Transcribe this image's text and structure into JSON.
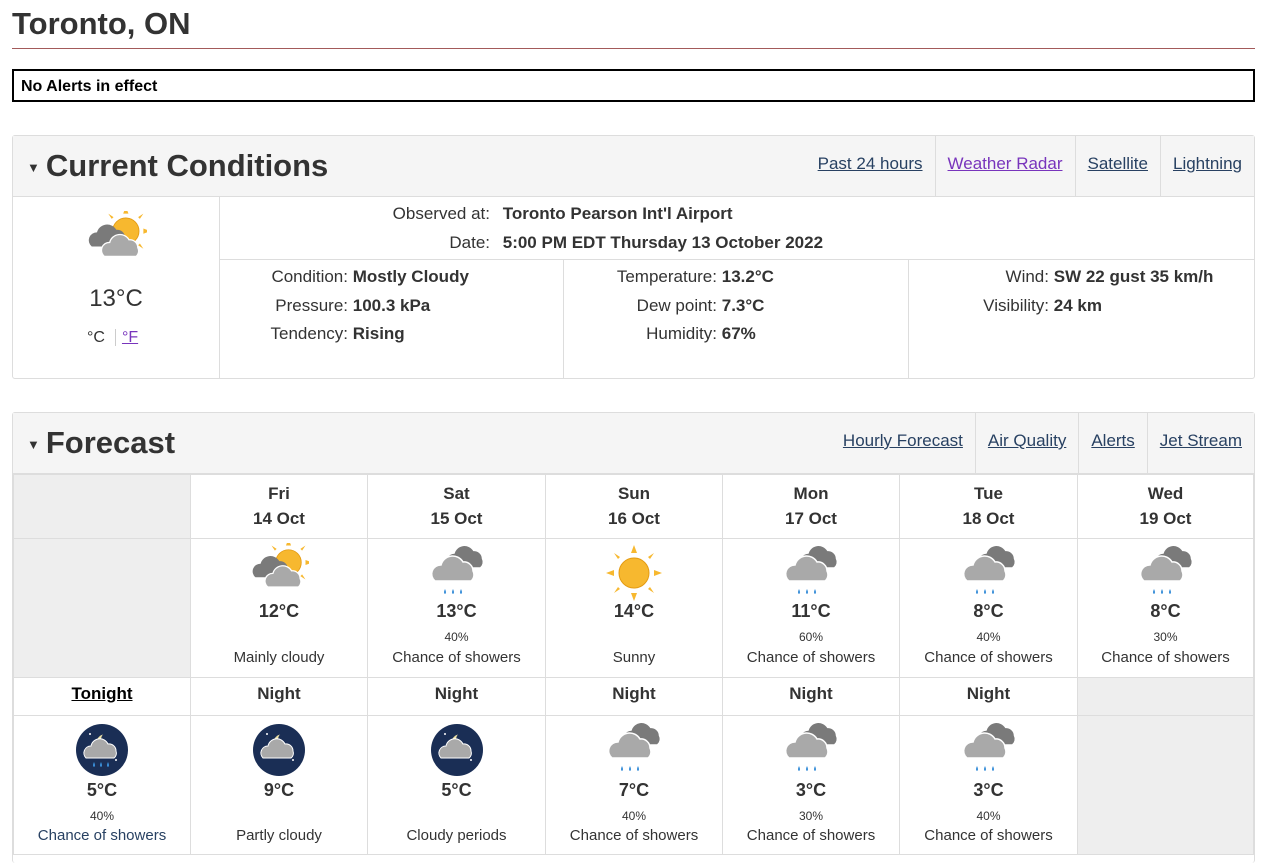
{
  "location": "Toronto, ON",
  "alerts_text": "No Alerts in effect",
  "current": {
    "section_title": "Current Conditions",
    "links": [
      "Past 24 hours",
      "Weather Radar",
      "Satellite",
      "Lightning"
    ],
    "temp": "13°C",
    "unit_c": "°C",
    "unit_f": "°F",
    "observed_label": "Observed at:",
    "observed_value": "Toronto Pearson Int'l Airport",
    "date_label": "Date:",
    "date_value": "5:00 PM EDT Thursday 13 October 2022",
    "condition_label": "Condition:",
    "condition_value": "Mostly Cloudy",
    "pressure_label": "Pressure:",
    "pressure_value": "100.3 kPa",
    "tendency_label": "Tendency:",
    "tendency_value": "Rising",
    "temperature_label": "Temperature:",
    "temperature_value": "13.2°C",
    "dewpoint_label": "Dew point:",
    "dewpoint_value": "7.3°C",
    "humidity_label": "Humidity:",
    "humidity_value": "67%",
    "wind_label": "Wind:",
    "wind_value": "SW 22 gust 35 km/h",
    "visibility_label": "Visibility:",
    "visibility_value": "24 km"
  },
  "forecast": {
    "section_title": "Forecast",
    "links": [
      "Hourly Forecast",
      "Air Quality",
      "Alerts",
      "Jet Stream"
    ],
    "days": [
      {
        "day": "Fri",
        "date": "14 Oct",
        "icon": "sun-cloud-icon",
        "temp": "12°C",
        "pop": "",
        "summary": "Mainly cloudy"
      },
      {
        "day": "Sat",
        "date": "15 Oct",
        "icon": "rain-cloud-icon",
        "temp": "13°C",
        "pop": "40%",
        "summary": "Chance of showers"
      },
      {
        "day": "Sun",
        "date": "16 Oct",
        "icon": "sun-icon",
        "temp": "14°C",
        "pop": "",
        "summary": "Sunny"
      },
      {
        "day": "Mon",
        "date": "17 Oct",
        "icon": "rain-cloud-icon",
        "temp": "11°C",
        "pop": "60%",
        "summary": "Chance of showers"
      },
      {
        "day": "Tue",
        "date": "18 Oct",
        "icon": "rain-cloud-icon",
        "temp": "8°C",
        "pop": "40%",
        "summary": "Chance of showers"
      },
      {
        "day": "Wed",
        "date": "19 Oct",
        "icon": "rain-cloud-icon",
        "temp": "8°C",
        "pop": "30%",
        "summary": "Chance of showers"
      }
    ],
    "nights": [
      {
        "label": "Tonight",
        "icon": "moon-rain-icon",
        "temp": "5°C",
        "pop": "40%",
        "summary": "Chance of showers"
      },
      {
        "label": "Night",
        "icon": "moon-cloud-icon",
        "temp": "9°C",
        "pop": "",
        "summary": "Partly cloudy"
      },
      {
        "label": "Night",
        "icon": "moon-cloud-icon",
        "temp": "5°C",
        "pop": "",
        "summary": "Cloudy periods"
      },
      {
        "label": "Night",
        "icon": "rain-cloud-icon",
        "temp": "7°C",
        "pop": "40%",
        "summary": "Chance of showers"
      },
      {
        "label": "Night",
        "icon": "rain-cloud-icon",
        "temp": "3°C",
        "pop": "30%",
        "summary": "Chance of showers"
      },
      {
        "label": "Night",
        "icon": "rain-cloud-icon",
        "temp": "3°C",
        "pop": "40%",
        "summary": "Chance of showers"
      }
    ]
  },
  "colors": {
    "link": "#284162",
    "visited": "#7834bc",
    "sun": "#f7b82f",
    "cloud": "#a9a9a9",
    "rain": "#3a8fd9",
    "moon_bg": "#1a2e55"
  }
}
